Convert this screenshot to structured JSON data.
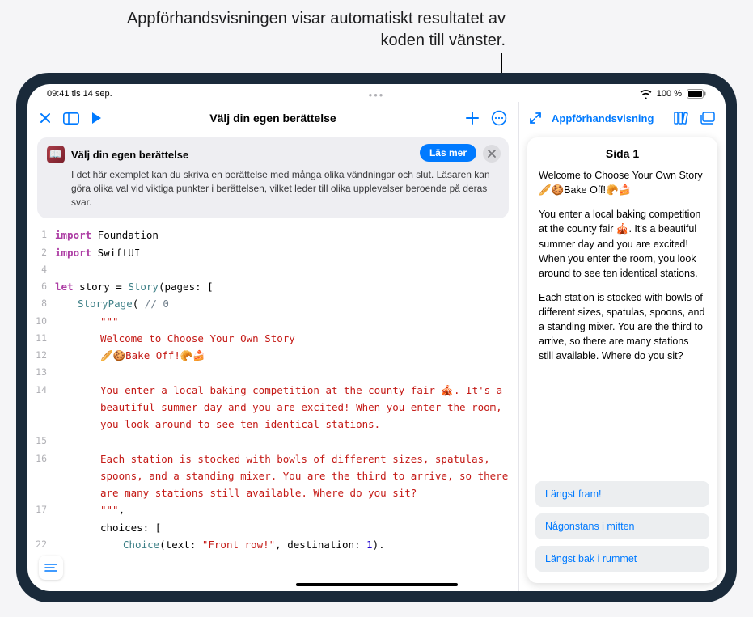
{
  "annotation": {
    "text": "Appförhandsvisningen visar automatiskt resultatet av koden till vänster."
  },
  "statusbar": {
    "time_date": "09:41  tis 14 sep.",
    "battery_text": "100 %"
  },
  "left": {
    "title": "Välj din egen berättelse",
    "info_card": {
      "title": "Välj din egen berättelse",
      "body": "I det här exemplet kan du skriva en berättelse med många olika vändningar och slut. Läsaren kan göra olika val vid viktiga punkter i berättelsen, vilket leder till olika upplevelser beroende på deras svar.",
      "read_more": "Läs mer"
    },
    "code": [
      {
        "n": "1",
        "ind": 0,
        "segs": [
          [
            "kw",
            "import"
          ],
          [
            "plain",
            " Foundation"
          ]
        ]
      },
      {
        "n": "2",
        "ind": 0,
        "segs": [
          [
            "kw",
            "import"
          ],
          [
            "plain",
            " SwiftUI"
          ]
        ]
      },
      {
        "n": "4",
        "ind": 0,
        "segs": []
      },
      {
        "n": "6",
        "ind": 0,
        "segs": [
          [
            "kw",
            "let"
          ],
          [
            "plain",
            " story = "
          ],
          [
            "type",
            "Story"
          ],
          [
            "plain",
            "(pages: ["
          ]
        ]
      },
      {
        "n": "8",
        "ind": 1,
        "segs": [
          [
            "type",
            "StoryPage"
          ],
          [
            "plain",
            "( "
          ],
          [
            "cmt",
            "// 0"
          ]
        ]
      },
      {
        "n": "10",
        "ind": 2,
        "segs": [
          [
            "str",
            "\"\"\""
          ]
        ]
      },
      {
        "n": "11",
        "ind": 2,
        "segs": [
          [
            "str",
            "Welcome to Choose Your Own Story"
          ]
        ]
      },
      {
        "n": "12",
        "ind": 2,
        "segs": [
          [
            "str",
            "🥖🍪Bake Off!🥐🍰"
          ]
        ]
      },
      {
        "n": "13",
        "ind": 2,
        "segs": []
      },
      {
        "n": "14",
        "ind": 2,
        "segs": [
          [
            "str",
            "You enter a local baking competition at the county fair 🎪. It's a beautiful summer day and you are excited! When you enter the room, you look around to see ten identical stations."
          ]
        ]
      },
      {
        "n": "15",
        "ind": 2,
        "segs": []
      },
      {
        "n": "16",
        "ind": 2,
        "segs": [
          [
            "str",
            "Each station is stocked with bowls of different sizes, spatulas, spoons, and a standing mixer. You are the third to arrive, so there are many stations still available. Where do you sit?"
          ]
        ]
      },
      {
        "n": "17",
        "ind": 2,
        "segs": [
          [
            "str",
            "\"\"\""
          ],
          [
            "plain",
            ","
          ]
        ]
      },
      {
        "n": "",
        "ind": 2,
        "segs": [
          [
            "plain",
            "choices: ["
          ]
        ]
      },
      {
        "n": "22",
        "ind": 3,
        "segs": [
          [
            "type",
            "Choice"
          ],
          [
            "plain",
            "(text: "
          ],
          [
            "str",
            "\"Front row!\""
          ],
          [
            "plain",
            ", destination: "
          ],
          [
            "num",
            "1"
          ],
          [
            "plain",
            ")."
          ]
        ]
      }
    ]
  },
  "right": {
    "preview_label": "Appförhandsvisning",
    "page_title": "Sida 1",
    "paragraphs": [
      "Welcome to Choose Your Own Story 🥖🍪Bake Off!🥐🍰",
      "You enter a local baking competition at the county fair 🎪. It's a beautiful summer day and you are excited! When you enter the room, you look around to see ten identical stations.",
      "Each station is stocked with bowls of different sizes, spatulas, spoons, and a standing mixer. You are the third to arrive, so there are many stations still available. Where do you sit?"
    ],
    "choices": [
      "Längst fram!",
      "Någonstans i mitten",
      "Längst bak i rummet"
    ]
  }
}
